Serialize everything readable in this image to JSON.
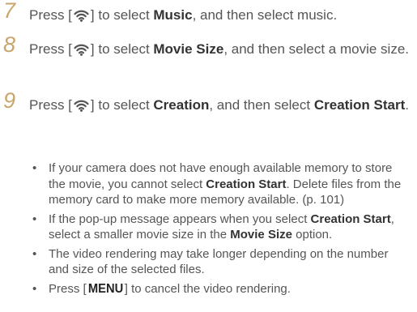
{
  "steps": [
    {
      "number": "7",
      "pre": "Press [",
      "post_icon": "] to select ",
      "bold1": "Music",
      "mid": ", and then select music.",
      "icon": "wifi-icon"
    },
    {
      "number": "8",
      "pre": "Press [",
      "post_icon": "] to select ",
      "bold1": "Movie Size",
      "mid": ", and then select a movie size.",
      "icon": "wifi-icon"
    },
    {
      "number": "9",
      "pre": "Press [",
      "post_icon": "] to select ",
      "bold1": "Creation",
      "mid": ", and then select ",
      "bold2": "Creation Start",
      "end": ".",
      "icon": "wifi-icon"
    }
  ],
  "bullets": [
    {
      "text1": "If your camera does not have enough available memory to store the movie, you cannot select ",
      "bold1": "Creation Start",
      "text2": ". Delete files from the memory card to make more memory available. (p. 101)"
    },
    {
      "text1": "If the pop-up message appears when you select ",
      "bold1": "Creation Start",
      "text2": ", select a smaller movie size in the ",
      "bold2": "Movie Size",
      "text3": " option."
    },
    {
      "text1": "The video rendering may take longer depending on the number and size of the selected files."
    },
    {
      "text1": "Press [",
      "key": "MENU",
      "text2": "] to cancel the video rendering."
    }
  ],
  "bullet_symbol": "•",
  "colors": {
    "step_number": "#c9a56b",
    "body_text": "#555555",
    "bold_text": "#333333"
  }
}
